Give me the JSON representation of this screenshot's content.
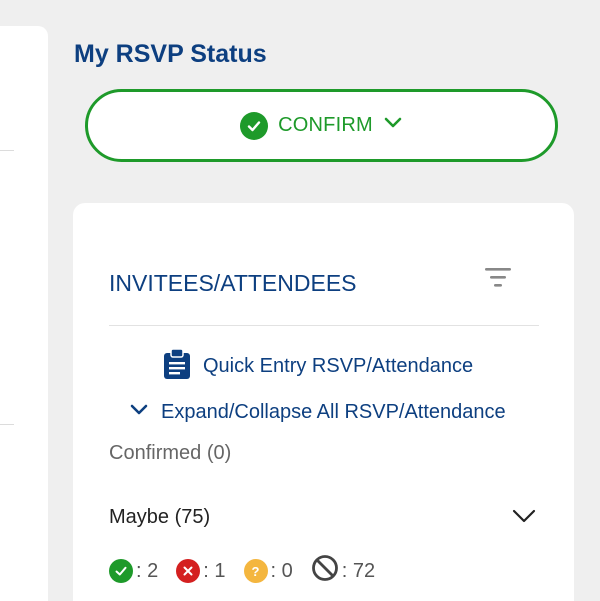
{
  "rsvp": {
    "title": "My RSVP Status",
    "status_label": "CONFIRM"
  },
  "card": {
    "title": "INVITEES/ATTENDEES",
    "quick_entry_label": "Quick Entry RSVP/Attendance",
    "expand_all_label": "Expand/Collapse All RSVP/Attendance"
  },
  "groups": {
    "confirmed_label": "Confirmed (0)",
    "maybe_label": "Maybe (75)"
  },
  "counts": [
    {
      "icon": "accepted-icon",
      "text": ": 2",
      "color": "#1e9a2a",
      "glyph": "✓"
    },
    {
      "icon": "declined-icon",
      "text": ": 1",
      "color": "#d42020",
      "glyph": "×"
    },
    {
      "icon": "tentative-icon",
      "text": ": 0",
      "color": "#f4b63f",
      "glyph": "?"
    },
    {
      "icon": "no-response-icon",
      "text": ": 72",
      "color": "#555555",
      "glyph": ""
    }
  ],
  "colors": {
    "brand_blue": "#0d3f80",
    "confirm_green": "#1e9a2a"
  }
}
